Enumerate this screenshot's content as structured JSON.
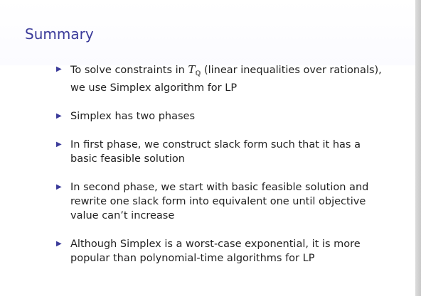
{
  "slide": {
    "title": "Summary",
    "bullets": [
      {
        "text_before_math": "To solve constraints in ",
        "math_symbol": "T",
        "math_subscript": "ℚ",
        "text_after_math": " (linear inequalities over rationals), we use Simplex algorithm for LP"
      },
      {
        "text": "Simplex has two phases"
      },
      {
        "text": "In first phase, we construct slack form such that it has a basic feasible solution"
      },
      {
        "text": "In second phase, we start with basic feasible solution and rewrite one slack form into equivalent one until objective value can’t increase"
      },
      {
        "text": "Although Simplex is a worst-case exponential, it is more popular than polynomial-time algorithms for LP"
      }
    ]
  },
  "icons": {
    "bullet": "triangle-right-icon"
  }
}
